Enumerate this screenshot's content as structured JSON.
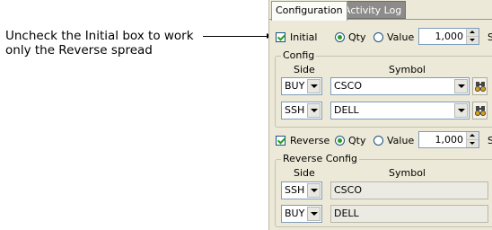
{
  "callout": {
    "line1": "Uncheck the Initial box to work",
    "line2": "only the Reverse spread"
  },
  "tabs": [
    {
      "label": "Configuration",
      "active": true
    },
    {
      "label": "Activity Log",
      "active": false
    }
  ],
  "initial": {
    "checkbox_label": "Initial",
    "checked": true,
    "qty_label": "Qty",
    "value_label": "Value",
    "selected_mode": "Qty",
    "quantity": "1,000",
    "edge_text": "S"
  },
  "config": {
    "title": "Config",
    "side_header": "Side",
    "symbol_header": "Symbol",
    "rows": [
      {
        "side": "BUY",
        "symbol": "CSCO"
      },
      {
        "side": "SSH",
        "symbol": "DELL"
      }
    ]
  },
  "reverse": {
    "checkbox_label": "Reverse",
    "checked": true,
    "qty_label": "Qty",
    "value_label": "Value",
    "selected_mode": "Qty",
    "quantity": "1,000",
    "edge_text": "S"
  },
  "reverse_config": {
    "title": "Reverse Config",
    "side_header": "Side",
    "symbol_header": "Symbol",
    "rows": [
      {
        "side": "SSH",
        "symbol": "CSCO"
      },
      {
        "side": "BUY",
        "symbol": "DELL"
      }
    ]
  },
  "colors": {
    "panel_bg": "#ece9d8",
    "check_green": "#21a121",
    "field_border": "#7f9db9",
    "inactive_tab": "#8e8c8a"
  }
}
